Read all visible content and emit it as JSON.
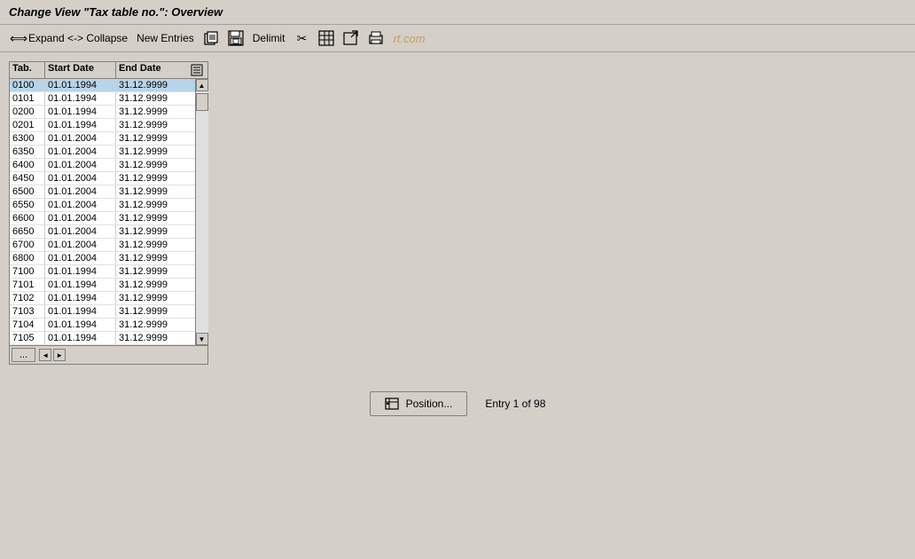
{
  "titleBar": {
    "text": "Change View \"Tax table no.\": Overview"
  },
  "toolbar": {
    "expandCollapseLabel": "Expand <-> Collapse",
    "newEntriesLabel": "New Entries",
    "delimitLabel": "Delimit",
    "watermark": "rt.com"
  },
  "table": {
    "columns": {
      "tab": "Tab.",
      "startDate": "Start Date",
      "endDate": "End Date"
    },
    "rows": [
      {
        "tab": "0100",
        "startDate": "01.01.1994",
        "endDate": "31.12.9999"
      },
      {
        "tab": "0101",
        "startDate": "01.01.1994",
        "endDate": "31.12.9999"
      },
      {
        "tab": "0200",
        "startDate": "01.01.1994",
        "endDate": "31.12.9999"
      },
      {
        "tab": "0201",
        "startDate": "01.01.1994",
        "endDate": "31.12.9999"
      },
      {
        "tab": "6300",
        "startDate": "01.01.2004",
        "endDate": "31.12.9999"
      },
      {
        "tab": "6350",
        "startDate": "01.01.2004",
        "endDate": "31.12.9999"
      },
      {
        "tab": "6400",
        "startDate": "01.01.2004",
        "endDate": "31.12.9999"
      },
      {
        "tab": "6450",
        "startDate": "01.01.2004",
        "endDate": "31.12.9999"
      },
      {
        "tab": "6500",
        "startDate": "01.01.2004",
        "endDate": "31.12.9999"
      },
      {
        "tab": "6550",
        "startDate": "01.01.2004",
        "endDate": "31.12.9999"
      },
      {
        "tab": "6600",
        "startDate": "01.01.2004",
        "endDate": "31.12.9999"
      },
      {
        "tab": "6650",
        "startDate": "01.01.2004",
        "endDate": "31.12.9999"
      },
      {
        "tab": "6700",
        "startDate": "01.01.2004",
        "endDate": "31.12.9999"
      },
      {
        "tab": "6800",
        "startDate": "01.01.2004",
        "endDate": "31.12.9999"
      },
      {
        "tab": "7100",
        "startDate": "01.01.1994",
        "endDate": "31.12.9999"
      },
      {
        "tab": "7101",
        "startDate": "01.01.1994",
        "endDate": "31.12.9999"
      },
      {
        "tab": "7102",
        "startDate": "01.01.1994",
        "endDate": "31.12.9999"
      },
      {
        "tab": "7103",
        "startDate": "01.01.1994",
        "endDate": "31.12.9999"
      },
      {
        "tab": "7104",
        "startDate": "01.01.1994",
        "endDate": "31.12.9999"
      },
      {
        "tab": "7105",
        "startDate": "01.01.1994",
        "endDate": "31.12.9999"
      }
    ]
  },
  "bottom": {
    "positionLabel": "Position...",
    "entryInfo": "Entry 1 of 98"
  }
}
